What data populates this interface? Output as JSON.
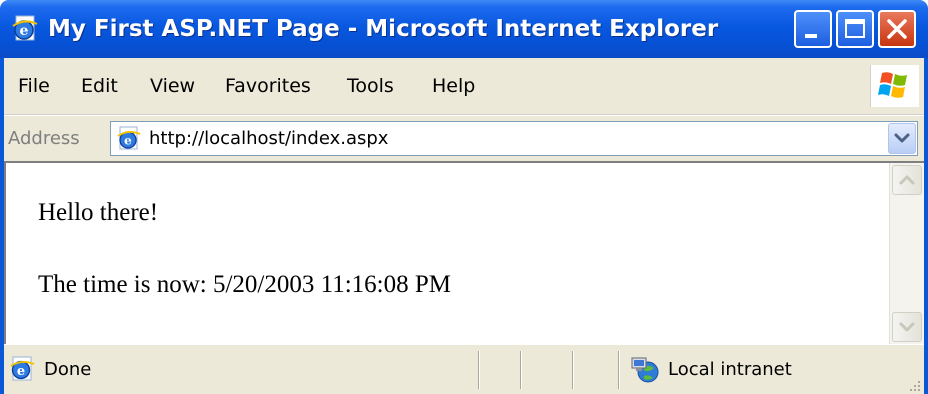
{
  "window": {
    "title": "My First ASP.NET Page - Microsoft Internet Explorer",
    "controls": [
      "minimize",
      "maximize",
      "close"
    ]
  },
  "menu": {
    "items": [
      "File",
      "Edit",
      "View",
      "Favorites",
      "Tools",
      "Help"
    ]
  },
  "address": {
    "label": "Address",
    "url": "http://localhost/index.aspx"
  },
  "content": {
    "greeting": "Hello there!",
    "time_line": "The time is now: 5/20/2003 11:16:08 PM"
  },
  "status": {
    "text": "Done",
    "zone": "Local intranet"
  },
  "colors": {
    "titlebar": "#0A58D8",
    "chrome": "#ECE9D8",
    "close_button": "#C63510"
  },
  "icons": [
    "ie-page-icon",
    "minimize-icon",
    "maximize-icon",
    "close-icon",
    "windows-logo-icon",
    "dropdown-arrow-icon",
    "scroll-up-icon",
    "scroll-down-icon",
    "done-page-icon",
    "local-intranet-icon",
    "resize-grip-icon"
  ]
}
